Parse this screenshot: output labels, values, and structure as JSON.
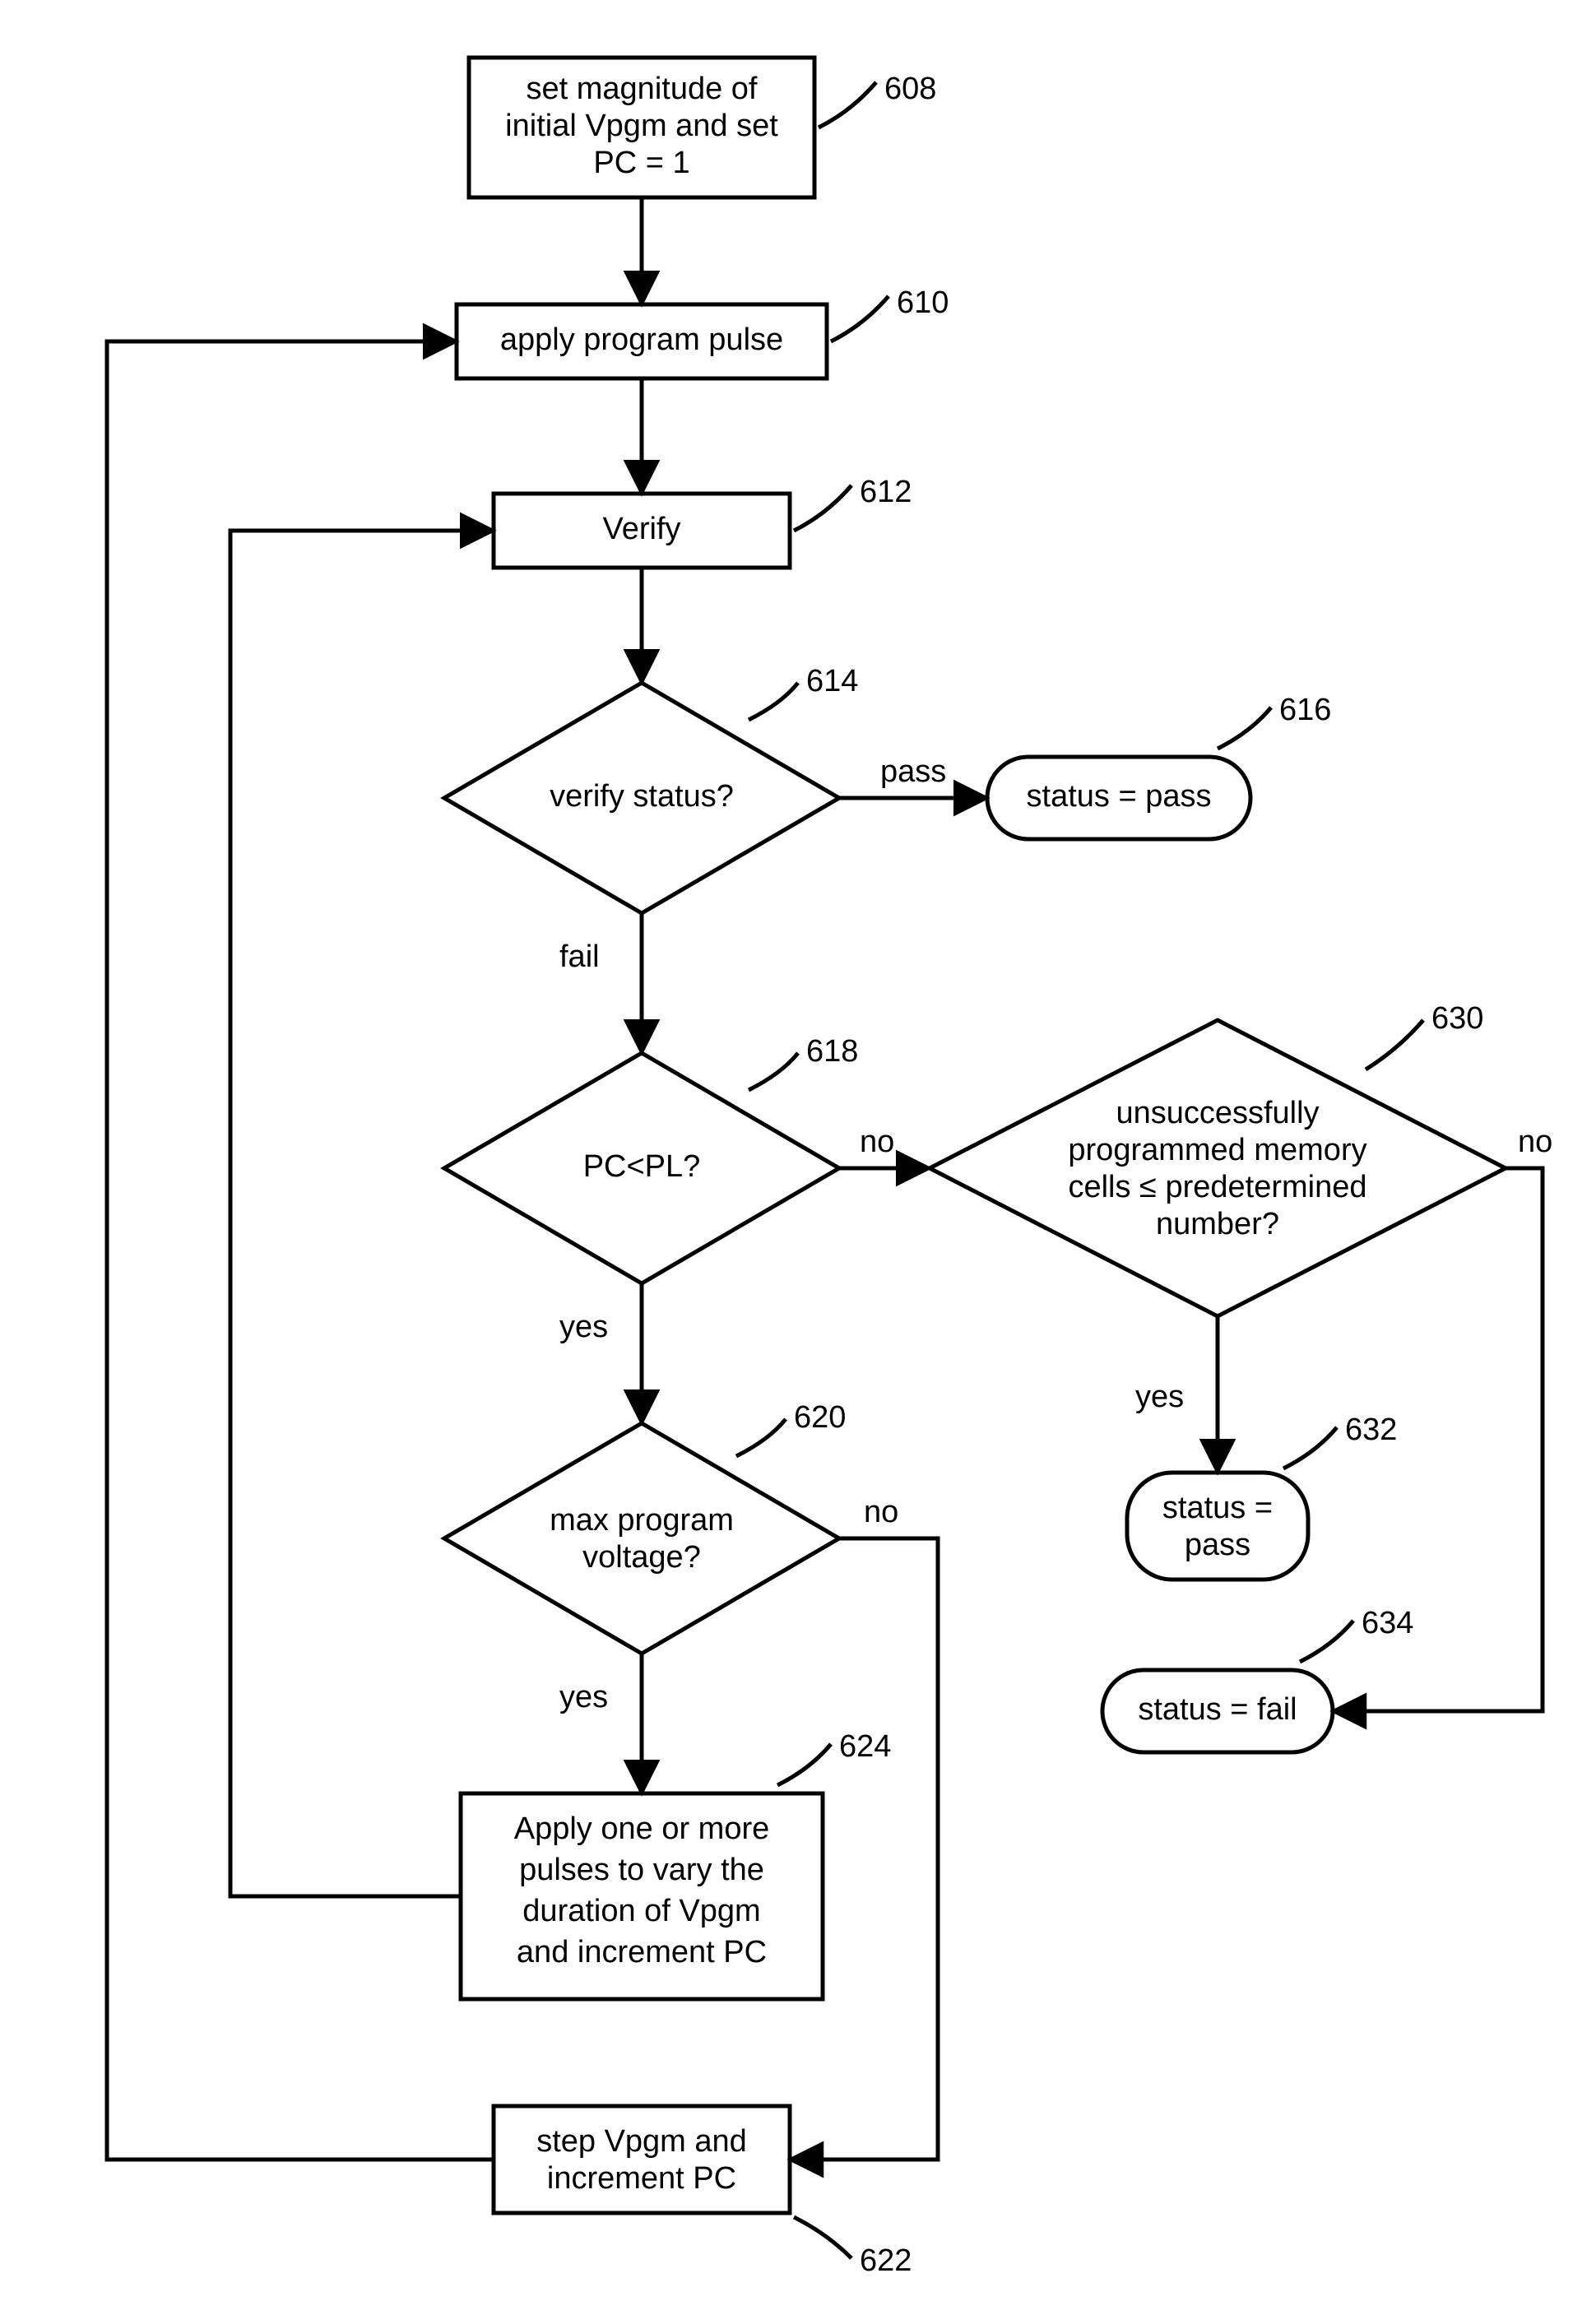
{
  "nodes": {
    "n608": {
      "ref": "608",
      "lines": [
        "set magnitude of",
        "initial Vpgm and set",
        "PC = 1"
      ]
    },
    "n610": {
      "ref": "610",
      "lines": [
        "apply program pulse"
      ]
    },
    "n612": {
      "ref": "612",
      "lines": [
        "Verify"
      ]
    },
    "n614": {
      "ref": "614",
      "lines": [
        "verify status?"
      ]
    },
    "n616": {
      "ref": "616",
      "lines": [
        "status = pass"
      ]
    },
    "n618": {
      "ref": "618",
      "lines": [
        "PC<PL?"
      ]
    },
    "n620": {
      "ref": "620",
      "lines": [
        "max program",
        "voltage?"
      ]
    },
    "n622": {
      "ref": "622",
      "lines": [
        "step Vpgm and",
        "increment PC"
      ]
    },
    "n624": {
      "ref": "624",
      "lines": [
        "Apply one or more",
        "pulses to vary the",
        "duration of Vpgm",
        "and increment PC"
      ]
    },
    "n630": {
      "ref": "630",
      "lines": [
        "unsuccessfully",
        "programmed memory",
        "cells ≤ predetermined",
        "number?"
      ]
    },
    "n632": {
      "ref": "632",
      "lines": [
        "status =",
        "pass"
      ]
    },
    "n634": {
      "ref": "634",
      "lines": [
        "status = fail"
      ]
    }
  },
  "edgeLabels": {
    "e614pass": "pass",
    "e614fail": "fail",
    "e618no": "no",
    "e618yes": "yes",
    "e620no": "no",
    "e620yes": "yes",
    "e630no": "no",
    "e630yes": "yes"
  }
}
